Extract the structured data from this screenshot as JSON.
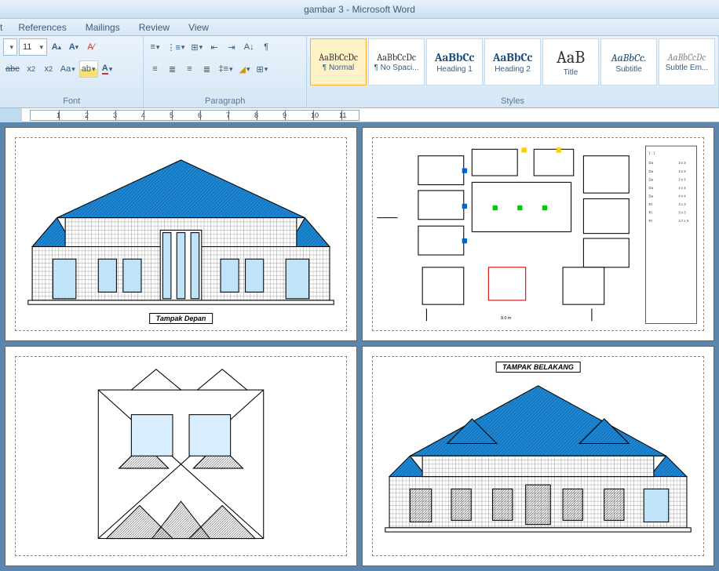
{
  "title": "gambar 3 - Microsoft Word",
  "menu": {
    "references": "References",
    "mailings": "Mailings",
    "review": "Review",
    "view": "View"
  },
  "font": {
    "size": "11",
    "group_label": "Font"
  },
  "paragraph": {
    "group_label": "Paragraph"
  },
  "styles": {
    "group_label": "Styles",
    "items": [
      {
        "preview": "AaBbCcDc",
        "name": "¶ Normal"
      },
      {
        "preview": "AaBbCcDc",
        "name": "¶ No Spaci..."
      },
      {
        "preview": "AaBbCc",
        "name": "Heading 1"
      },
      {
        "preview": "AaBbCc",
        "name": "Heading 2"
      },
      {
        "preview": "AaB",
        "name": "Title"
      },
      {
        "preview": "AaBbCc.",
        "name": "Subtitle"
      },
      {
        "preview": "AaBbCcDc",
        "name": "Subtle Em..."
      }
    ]
  },
  "ruler_numbers": [
    "1",
    "2",
    "3",
    "4",
    "5",
    "6",
    "7",
    "8",
    "9",
    "10",
    "11"
  ],
  "doc": {
    "front_label": "Tampak Depan",
    "back_label": "TAMPAK BELAKANG"
  }
}
